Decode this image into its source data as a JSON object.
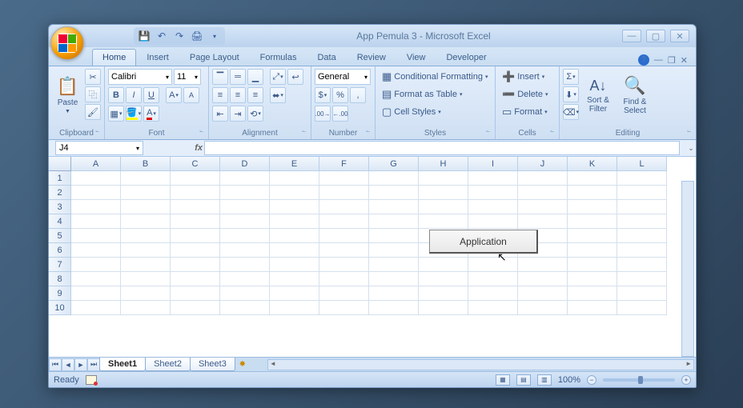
{
  "app": {
    "title": "App Pemula 3 - Microsoft Excel"
  },
  "qat": {
    "save": "💾",
    "undo": "↶",
    "redo": "↷",
    "print": "🖨"
  },
  "tabs": {
    "home": "Home",
    "insert": "Insert",
    "pagelayout": "Page Layout",
    "formulas": "Formulas",
    "data": "Data",
    "review": "Review",
    "view": "View",
    "developer": "Developer"
  },
  "ribbon": {
    "clipboard": {
      "paste": "Paste",
      "label": "Clipboard"
    },
    "font": {
      "name": "Calibri",
      "size": "11",
      "label": "Font"
    },
    "alignment": {
      "label": "Alignment"
    },
    "number": {
      "format": "General",
      "label": "Number"
    },
    "styles": {
      "cf": "Conditional Formatting",
      "fat": "Format as Table",
      "cs": "Cell Styles",
      "label": "Styles"
    },
    "cells": {
      "ins": "Insert",
      "del": "Delete",
      "fmt": "Format",
      "label": "Cells"
    },
    "editing": {
      "sort": "Sort & Filter",
      "find": "Find & Select",
      "label": "Editing"
    }
  },
  "formula": {
    "cellref": "J4",
    "fx": "fx"
  },
  "grid": {
    "cols": [
      "A",
      "B",
      "C",
      "D",
      "E",
      "F",
      "G",
      "H",
      "I",
      "J",
      "K",
      "L"
    ],
    "rows": [
      "1",
      "2",
      "3",
      "4",
      "5",
      "6",
      "7",
      "8",
      "9",
      "10"
    ]
  },
  "shape": {
    "label": "Application"
  },
  "sheets": {
    "s1": "Sheet1",
    "s2": "Sheet2",
    "s3": "Sheet3"
  },
  "status": {
    "ready": "Ready",
    "zoom": "100%"
  }
}
